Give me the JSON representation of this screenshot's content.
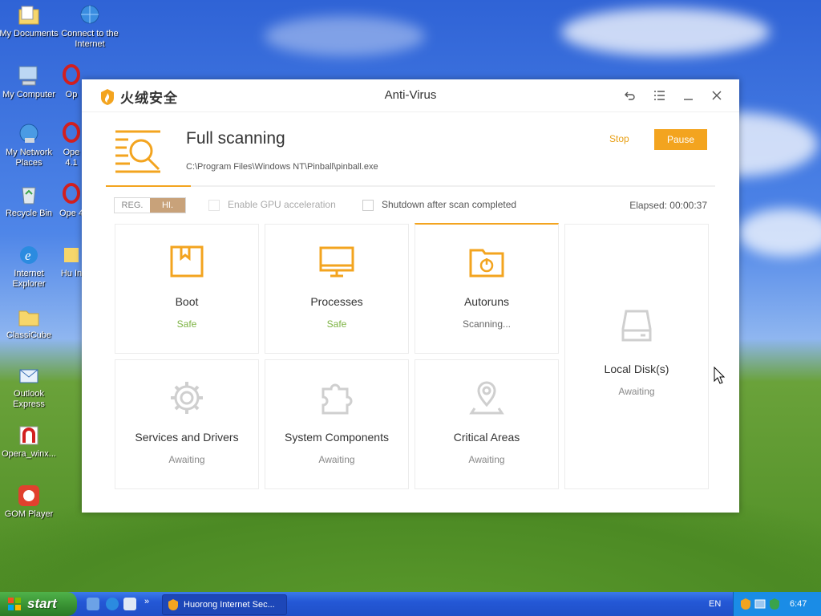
{
  "desktop": {
    "icons": [
      {
        "label": "My Documents",
        "icon": "folder-docs-icon"
      },
      {
        "label": "Connect to the Internet",
        "icon": "globe-shortcut-icon"
      },
      {
        "label": "My Computer",
        "icon": "computer-icon"
      },
      {
        "label": "Op",
        "icon": "opera-icon"
      },
      {
        "label": "My Network Places",
        "icon": "network-icon"
      },
      {
        "label": "Ope 4.1",
        "icon": "opera-icon"
      },
      {
        "label": "Recycle Bin",
        "icon": "recycle-bin-icon"
      },
      {
        "label": "Ope 4",
        "icon": "opera-icon"
      },
      {
        "label": "Internet Explorer",
        "icon": "ie-icon"
      },
      {
        "label": "Hu In",
        "icon": "shortcut-icon"
      },
      {
        "label": "ClassiCube",
        "icon": "folder-icon"
      },
      {
        "label": "Outlook Express",
        "icon": "outlook-icon"
      },
      {
        "label": "Opera_winx...",
        "icon": "installer-icon"
      },
      {
        "label": "GOM Player",
        "icon": "gom-player-icon"
      }
    ]
  },
  "window": {
    "brand": "火绒安全",
    "title": "Anti-Virus",
    "controls": [
      "back-icon",
      "menu-icon",
      "minimize-icon",
      "close-icon"
    ]
  },
  "scan": {
    "title": "Full scanning",
    "path": "C:\\Program Files\\Windows NT\\Pinball\\pinball.exe",
    "stop_label": "Stop",
    "pause_label": "Pause",
    "progress": 0.14
  },
  "options": {
    "seg_a": "REG.",
    "seg_b": "HI.",
    "gpu_label": "Enable GPU acceleration",
    "shutdown_label": "Shutdown after scan completed",
    "elapsed": "Elapsed: 00:00:37"
  },
  "tiles": [
    {
      "name": "Boot",
      "status": "Safe",
      "icon": "bookmark-box-icon"
    },
    {
      "name": "Processes",
      "status": "Safe",
      "icon": "monitor-icon"
    },
    {
      "name": "Autoruns",
      "status": "Scanning...",
      "icon": "power-folder-icon"
    },
    {
      "name": "Local Disk(s)",
      "status": "Awaiting",
      "icon": "disk-drive-icon"
    },
    {
      "name": "Services and Drivers",
      "status": "Awaiting",
      "icon": "gear-icon"
    },
    {
      "name": "System Components",
      "status": "Awaiting",
      "icon": "puzzle-icon"
    },
    {
      "name": "Critical Areas",
      "status": "Awaiting",
      "icon": "map-pin-icon"
    }
  ],
  "taskbar": {
    "start_label": "start",
    "task_label": "Huorong Internet Sec...",
    "lang": "EN",
    "clock": "6:47"
  },
  "colors": {
    "accent": "#f3a41f",
    "safe": "#7cb342",
    "muted": "#888888"
  }
}
